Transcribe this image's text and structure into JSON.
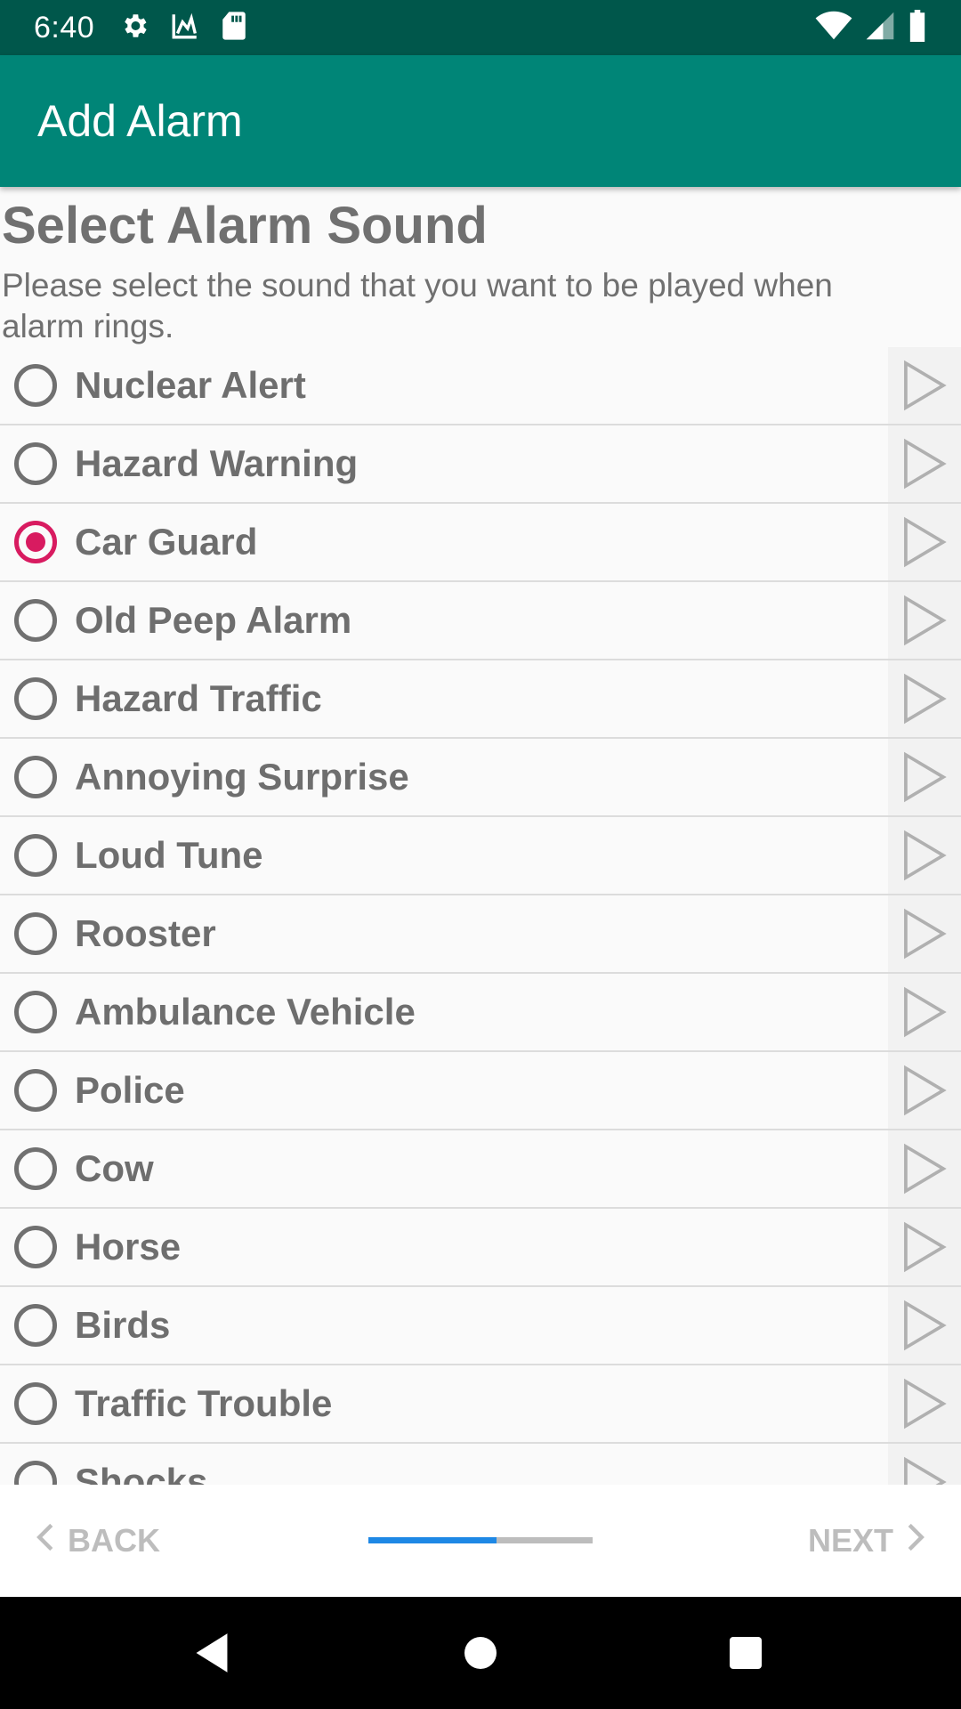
{
  "status_bar": {
    "time": "6:40",
    "icons_left": [
      "settings-icon",
      "signal-chart-icon",
      "sd-card-icon"
    ],
    "icons_right": [
      "wifi-icon",
      "cell-signal-icon",
      "battery-icon"
    ]
  },
  "app_bar": {
    "title": "Add Alarm"
  },
  "page": {
    "heading": "Select Alarm Sound",
    "subtitle": "Please select the sound that you want to be played when alarm rings."
  },
  "sounds": [
    {
      "label": "Nuclear Alert",
      "selected": false
    },
    {
      "label": "Hazard Warning",
      "selected": false
    },
    {
      "label": "Car Guard",
      "selected": true
    },
    {
      "label": "Old Peep Alarm",
      "selected": false
    },
    {
      "label": "Hazard Traffic",
      "selected": false
    },
    {
      "label": "Annoying Surprise",
      "selected": false
    },
    {
      "label": "Loud Tune",
      "selected": false
    },
    {
      "label": "Rooster",
      "selected": false
    },
    {
      "label": "Ambulance Vehicle",
      "selected": false
    },
    {
      "label": "Police",
      "selected": false
    },
    {
      "label": "Cow",
      "selected": false
    },
    {
      "label": "Horse",
      "selected": false
    },
    {
      "label": "Birds",
      "selected": false
    },
    {
      "label": "Traffic Trouble",
      "selected": false
    },
    {
      "label": "Shocks",
      "selected": false
    }
  ],
  "bottom_nav": {
    "back_label": "BACK",
    "next_label": "NEXT",
    "progress_fraction": 0.57
  },
  "colors": {
    "status_bar": "#00574b",
    "app_bar": "#008577",
    "accent": "#d81b60",
    "progress": "#1e88e5"
  }
}
